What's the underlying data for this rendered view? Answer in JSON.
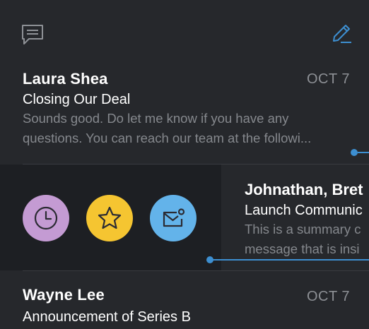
{
  "toolbar": {
    "left_icon": "chat-bubble-icon",
    "right_icon": "compose-pencil-icon"
  },
  "emails": [
    {
      "sender": "Laura Shea",
      "date": "OCT 7",
      "subject": "Closing Our Deal",
      "preview_line1": "Sounds good. Do let me know if you have any",
      "preview_line2": "questions. You can reach our team at the followi..."
    },
    {
      "sender": "Johnathan, Bret",
      "subject": "Launch Communic",
      "preview_line1": "This is a summary c",
      "preview_line2": "message that is insi",
      "swipe_actions": [
        {
          "name": "snooze",
          "icon": "clock-icon",
          "color": "#c49bd3"
        },
        {
          "name": "star",
          "icon": "star-icon",
          "color": "#f5c531"
        },
        {
          "name": "mark-unread",
          "icon": "envelope-unread-icon",
          "color": "#63b3ea"
        }
      ]
    },
    {
      "sender": "Wayne Lee",
      "date": "OCT 7",
      "subject": "Announcement of Series B"
    }
  ],
  "colors": {
    "background": "#26282c",
    "swipe_background": "#1d1f23",
    "accent": "#3d8fd1",
    "muted_text": "#85888d"
  }
}
